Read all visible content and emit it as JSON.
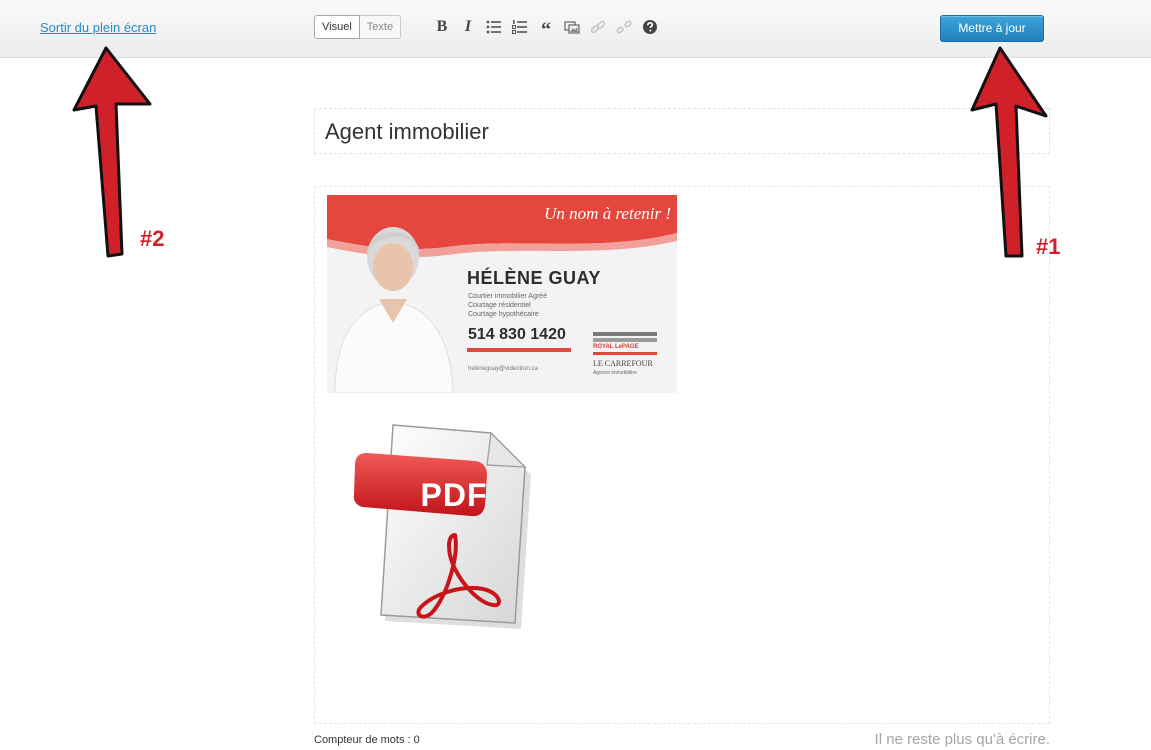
{
  "toolbar": {
    "exit_fullscreen_label": "Sortir du plein écran",
    "mode_tabs": [
      {
        "label": "Visuel",
        "active": true
      },
      {
        "label": "Texte",
        "active": false
      }
    ],
    "tools": [
      {
        "name": "bold",
        "glyph": "B",
        "enabled": true
      },
      {
        "name": "italic",
        "glyph": "I",
        "enabled": true
      },
      {
        "name": "bullet-list",
        "icon": "bullet-list-icon",
        "enabled": true
      },
      {
        "name": "numbered-list",
        "icon": "numbered-list-icon",
        "enabled": true
      },
      {
        "name": "blockquote",
        "glyph": "“",
        "enabled": true
      },
      {
        "name": "add-media",
        "icon": "media-icon",
        "enabled": true
      },
      {
        "name": "insert-link",
        "icon": "link-icon",
        "enabled": false
      },
      {
        "name": "remove-link",
        "icon": "unlink-icon",
        "enabled": false
      },
      {
        "name": "help",
        "icon": "help-icon",
        "enabled": true
      }
    ],
    "update_button_label": "Mettre à jour"
  },
  "editor": {
    "title": "Agent immobilier",
    "business_card": {
      "slogan": "Un nom à retenir !",
      "name": "HÉLÈNE GUAY",
      "roles": [
        "Courtier immobilier Agréé",
        "Courtage résidentiel",
        "Courtage hypothécaire"
      ],
      "phone": "514 830 1420",
      "email": "heleneguay@videotron.ca",
      "brand": "ROYAL LePAGE",
      "office": "LE CARREFOUR",
      "agency": "Agence immobilière"
    },
    "pdf_icon_label": "PDF"
  },
  "footer": {
    "word_count_label": "Compteur de mots : 0",
    "hint": "Il ne reste plus qu'à écrire."
  },
  "annotations": [
    {
      "label": "#1"
    },
    {
      "label": "#2"
    }
  ],
  "colors": {
    "accent_blue": "#2a8bc1",
    "annotation_red": "#d0212a",
    "card_red": "#e5473f"
  }
}
